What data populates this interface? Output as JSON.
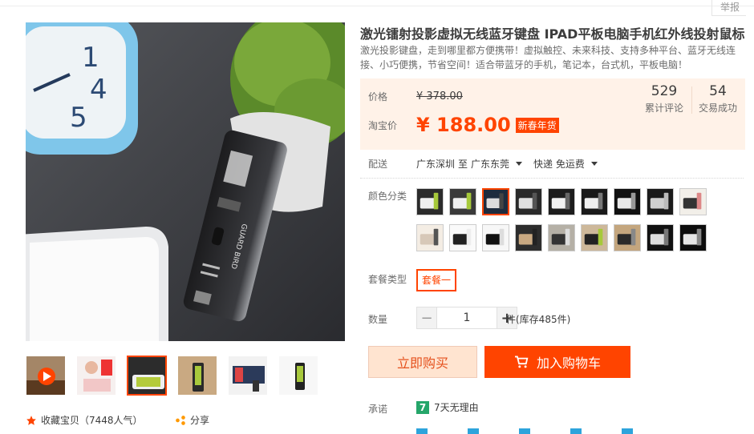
{
  "header": {
    "report_label": "举报"
  },
  "product": {
    "title": "激光镭射投影虚拟无线蓝牙键盘 IPAD平板电脑手机红外线投射鼠标",
    "subtitle": "激光投影键盘，走到哪里都方便携带！虚拟触控、未来科技、支持多种平台、蓝牙无线连接、小巧便携，节省空间！适合带蓝牙的手机，笔记本，台式机，平板电脑！"
  },
  "price": {
    "list_label": "价格",
    "list_price": "¥ 378.00",
    "taobao_label": "淘宝价",
    "taobao_price": "¥ 188.00",
    "promo_badge": "新春年货",
    "reviews_count": "529",
    "reviews_label": "累计评论",
    "sales_count": "54",
    "sales_label": "交易成功"
  },
  "shipping": {
    "label": "配送",
    "from": "广东深圳",
    "to_word": "至",
    "to": "广东东莞",
    "method": "快递 免运费"
  },
  "sku": {
    "color_label": "颜色分类",
    "selected_index": 2,
    "package_label": "套餐类型",
    "package_value": "套餐一"
  },
  "quantity": {
    "label": "数量",
    "value": "1",
    "minus": "−",
    "plus": "+",
    "stock": "件(库存485件)"
  },
  "actions": {
    "buy_now": "立即购买",
    "add_to_cart": "加入购物车"
  },
  "promise": {
    "label": "承诺",
    "icon_text": "7",
    "item": "7天无理由"
  },
  "gallery": {
    "favorite": "收藏宝贝（7448人气）",
    "share": "分享"
  },
  "colors": {
    "accent": "#ff4400",
    "price_bg": "#fff2e8",
    "promise_green": "#25a66a"
  }
}
